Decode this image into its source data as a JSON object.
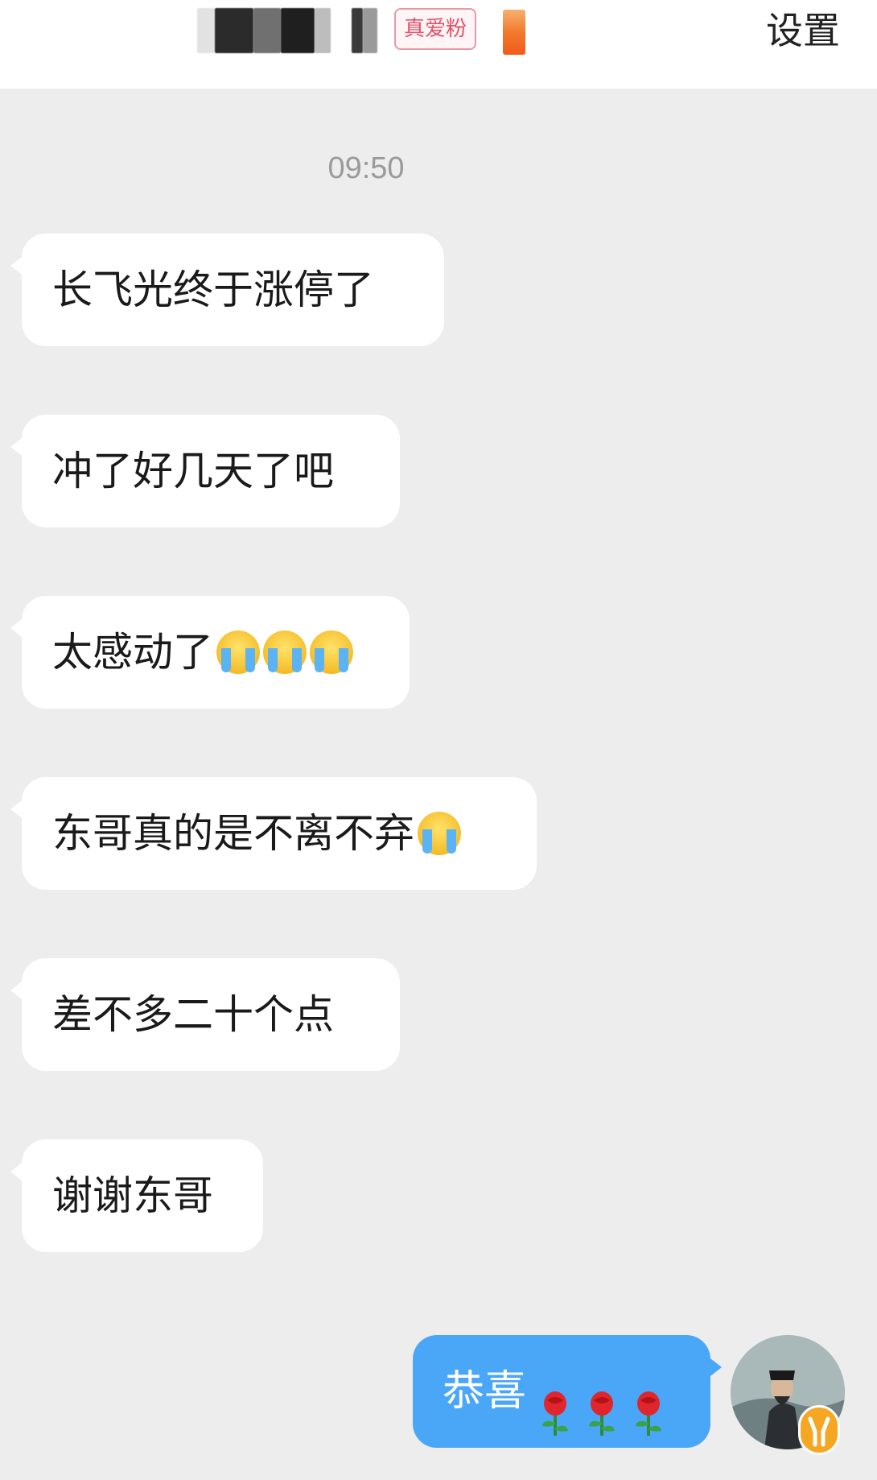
{
  "header": {
    "badge_label": "真爱粉",
    "settings_label": "设置"
  },
  "chat": {
    "timestamp": "09:50",
    "messages": [
      {
        "text": "长飞光终于涨停了",
        "emoji_count": 0
      },
      {
        "text": "冲了好几天了吧",
        "emoji_count": 0
      },
      {
        "text": "太感动了",
        "emoji_count": 3
      },
      {
        "text": "东哥真的是不离不弃",
        "emoji_count": 1
      },
      {
        "text": "差不多二十个点",
        "emoji_count": 0
      },
      {
        "text": "谢谢东哥",
        "emoji_count": 0
      }
    ],
    "my_message": {
      "text": "恭喜",
      "rose_count": 3
    }
  },
  "icons": {
    "cry_emoji": "loudly-crying-face-emoji",
    "rose_emoji": "rose-emoji"
  },
  "colors": {
    "background": "#ededed",
    "my_bubble": "#4aa6f7",
    "other_bubble": "#ffffff",
    "badge_text": "#e2526b"
  }
}
